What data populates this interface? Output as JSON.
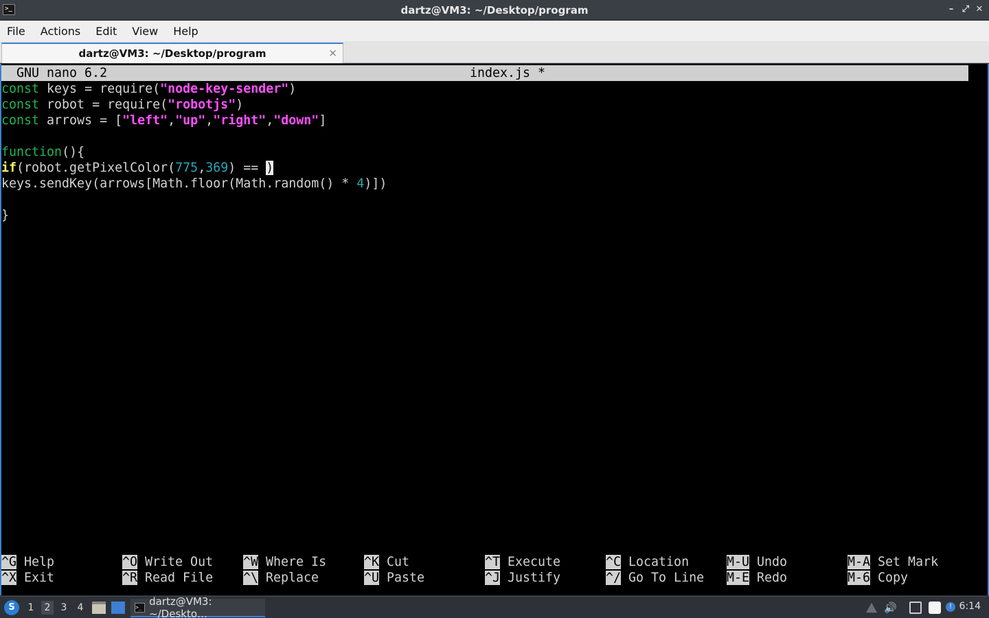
{
  "window": {
    "title": "dartz@VM3: ~/Desktop/program",
    "controls": [
      "minimize-icon",
      "restore-icon",
      "close-icon"
    ]
  },
  "menu": [
    "File",
    "Actions",
    "Edit",
    "View",
    "Help"
  ],
  "tab": {
    "label": "dartz@VM3: ~/Desktop/program",
    "close": "×"
  },
  "nano": {
    "version": "GNU nano 6.2",
    "filename": "index.js *"
  },
  "code_lines": [
    [
      {
        "t": "const",
        "c": "kw"
      },
      {
        "t": " keys = require(",
        "c": ""
      },
      {
        "t": "\"node-key-sender\"",
        "c": "str"
      },
      {
        "t": ")",
        "c": ""
      }
    ],
    [
      {
        "t": "const",
        "c": "kw"
      },
      {
        "t": " robot = require(",
        "c": ""
      },
      {
        "t": "\"robotjs\"",
        "c": "str"
      },
      {
        "t": ")",
        "c": ""
      }
    ],
    [
      {
        "t": "const",
        "c": "kw"
      },
      {
        "t": " arrows = [",
        "c": ""
      },
      {
        "t": "\"left\"",
        "c": "str"
      },
      {
        "t": ",",
        "c": ""
      },
      {
        "t": "\"up\"",
        "c": "str"
      },
      {
        "t": ",",
        "c": ""
      },
      {
        "t": "\"right\"",
        "c": "str"
      },
      {
        "t": ",",
        "c": ""
      },
      {
        "t": "\"down\"",
        "c": "str"
      },
      {
        "t": "]",
        "c": ""
      }
    ],
    [],
    [
      {
        "t": "function",
        "c": "kw"
      },
      {
        "t": "(){",
        "c": ""
      }
    ],
    [
      {
        "t": "if",
        "c": "ifkw"
      },
      {
        "t": "(robot.getPixelColor(",
        "c": ""
      },
      {
        "t": "775",
        "c": "num"
      },
      {
        "t": ",",
        "c": ""
      },
      {
        "t": "369",
        "c": "num"
      },
      {
        "t": ") == ",
        "c": ""
      },
      {
        "t": ")",
        "c": "cursor"
      }
    ],
    [
      {
        "t": "keys.sendKey(arrows[Math.floor(Math.random() * ",
        "c": ""
      },
      {
        "t": "4",
        "c": "num"
      },
      {
        "t": ")])",
        "c": ""
      }
    ],
    [],
    [
      {
        "t": "}",
        "c": ""
      }
    ]
  ],
  "shortcuts": [
    {
      "key": "^G",
      "label": "Help"
    },
    {
      "key": "^X",
      "label": "Exit"
    },
    {
      "key": "^O",
      "label": "Write Out"
    },
    {
      "key": "^R",
      "label": "Read File"
    },
    {
      "key": "^W",
      "label": "Where Is"
    },
    {
      "key": "^\\",
      "label": "Replace"
    },
    {
      "key": "^K",
      "label": "Cut"
    },
    {
      "key": "^U",
      "label": "Paste"
    },
    {
      "key": "^T",
      "label": "Execute"
    },
    {
      "key": "^J",
      "label": "Justify"
    },
    {
      "key": "^C",
      "label": "Location"
    },
    {
      "key": "^/",
      "label": "Go To Line"
    },
    {
      "key": "M-U",
      "label": "Undo"
    },
    {
      "key": "M-E",
      "label": "Redo"
    },
    {
      "key": "M-A",
      "label": "Set Mark"
    },
    {
      "key": "M-6",
      "label": "Copy"
    }
  ],
  "taskbar": {
    "desktops": [
      "1",
      "2",
      "3",
      "4"
    ],
    "active_desktop": "2",
    "task_label": "dartz@VM3: ~/Deskto…",
    "clock": "6:14"
  }
}
